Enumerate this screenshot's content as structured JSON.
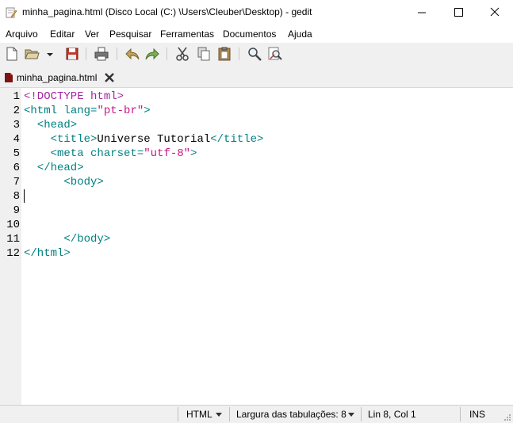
{
  "window": {
    "title": "minha_pagina.html (Disco Local (C:) \\Users\\Cleuber\\Desktop) - gedit"
  },
  "menu": {
    "items": [
      "Arquivo",
      "Editar",
      "Ver",
      "Pesquisar",
      "Ferramentas",
      "Documentos",
      "Ajuda"
    ]
  },
  "toolbar": {
    "icons": [
      "new-document-icon",
      "open-folder-icon",
      "open-dropdown-icon",
      "save-icon",
      "print-icon",
      "undo-icon",
      "redo-icon",
      "cut-icon",
      "copy-icon",
      "paste-icon",
      "find-icon",
      "find-replace-icon"
    ]
  },
  "tab": {
    "label": "minha_pagina.html"
  },
  "editor": {
    "line_numbers": [
      "1",
      "2",
      "3",
      "4",
      "5",
      "6",
      "7",
      "8",
      "9",
      "10",
      "11",
      "12"
    ],
    "lines": [
      [
        {
          "t": "<!DOCTYPE html>",
          "c": "doc"
        }
      ],
      [
        {
          "t": "<html ",
          "c": "tag"
        },
        {
          "t": "lang=",
          "c": "attr"
        },
        {
          "t": "\"pt-br\"",
          "c": "val"
        },
        {
          "t": ">",
          "c": "tag"
        }
      ],
      [
        {
          "t": "  <head>",
          "c": "tag"
        }
      ],
      [
        {
          "t": "    <title>",
          "c": "tag"
        },
        {
          "t": "Universe Tutorial",
          "c": "txt"
        },
        {
          "t": "</title>",
          "c": "tag"
        }
      ],
      [
        {
          "t": "    <meta ",
          "c": "tag"
        },
        {
          "t": "charset=",
          "c": "attr"
        },
        {
          "t": "\"utf-8\"",
          "c": "val"
        },
        {
          "t": ">",
          "c": "tag"
        }
      ],
      [
        {
          "t": "  </head>",
          "c": "tag"
        }
      ],
      [
        {
          "t": "      <body>",
          "c": "tag"
        }
      ],
      [],
      [],
      [],
      [
        {
          "t": "      </body>",
          "c": "tag"
        }
      ],
      [
        {
          "t": "</html>",
          "c": "tag"
        }
      ]
    ]
  },
  "status": {
    "language": "HTML",
    "tab_width": "Largura das tabulações:  8",
    "position": "Lin 8, Col 1",
    "mode": "INS"
  }
}
